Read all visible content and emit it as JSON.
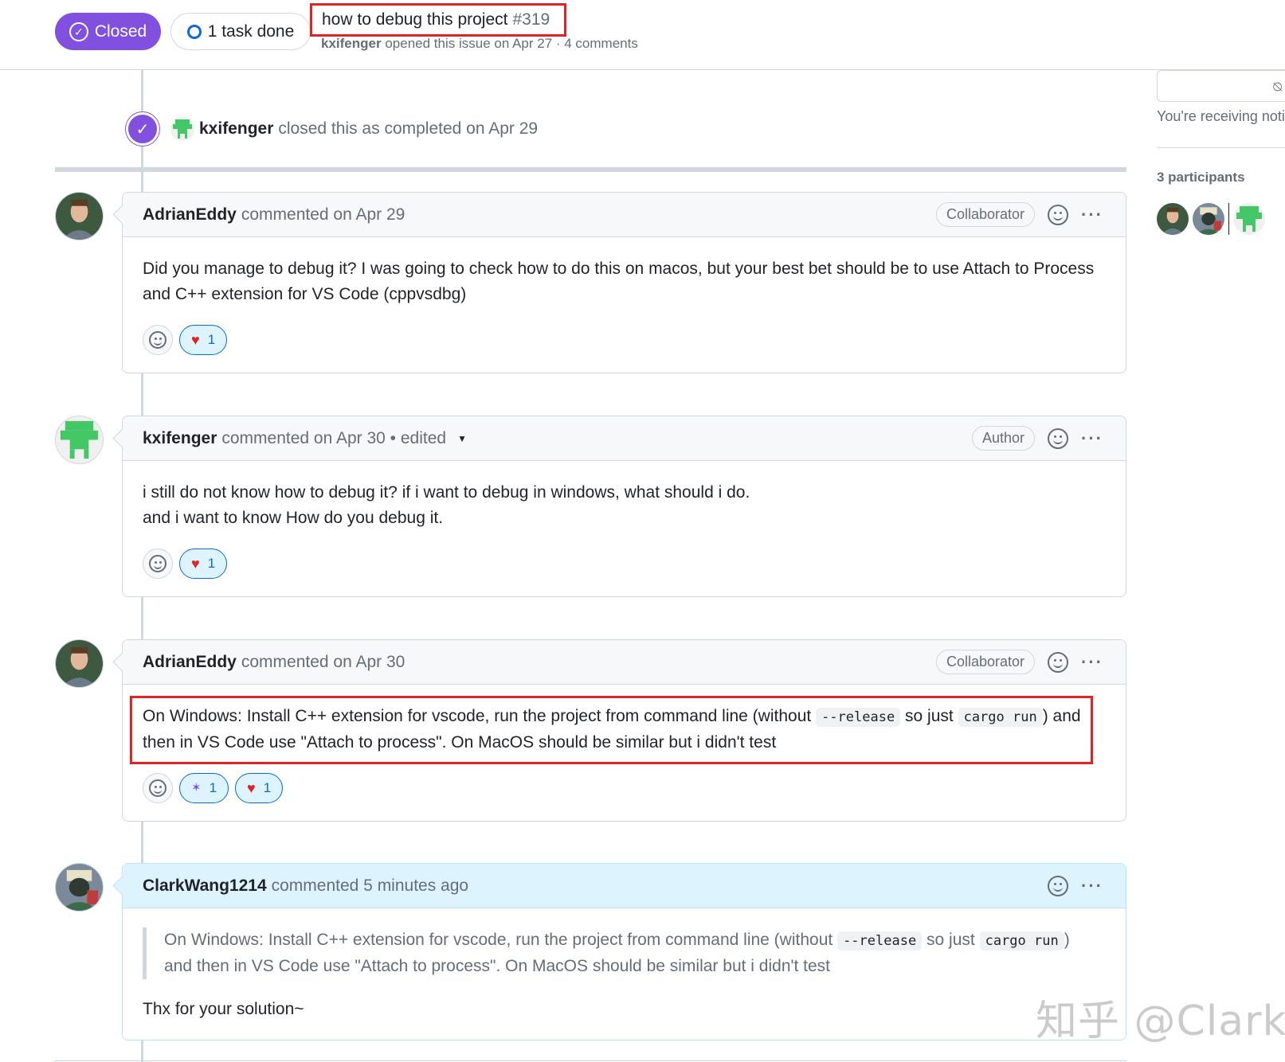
{
  "header": {
    "state_label": "Closed",
    "task_label": "1 task done",
    "title": "how to debug this project",
    "number": "#319",
    "meta_author": "kxifenger",
    "meta_text": "opened this issue on Apr 27 · 4 comments"
  },
  "event": {
    "author": "kxifenger",
    "text": "closed this as completed on Apr 29"
  },
  "comments": [
    {
      "author": "AdrianEddy",
      "header_text": "commented on Apr 29",
      "role": "Collaborator",
      "body_line1": "Did you manage to debug it? I was going to check how to do this on macos, but your best bet should be to use Attach to Process",
      "body_line2": "and C++ extension for VS Code (cppvsdbg)",
      "reaction_heart_count": "1"
    },
    {
      "author": "kxifenger",
      "header_text": "commented on Apr 30 • edited",
      "role": "Author",
      "body_line1": "i still do not know how to debug it? if i want to debug in windows, what should i do.",
      "body_line2": "and i want to know How do you debug it.",
      "reaction_heart_count": "1"
    },
    {
      "author": "AdrianEddy",
      "header_text": "commented on Apr 30",
      "role": "Collaborator",
      "body_part1": "On Windows: Install C++ extension for vscode, run the project from command line (without",
      "code1": "--release",
      "body_part2": "so just",
      "code2": "cargo run",
      "body_part3": ") and",
      "body_line2": "then in VS Code use \"Attach to process\". On MacOS should be similar but i didn't test",
      "reaction_hooray_count": "1",
      "reaction_heart_count": "1"
    },
    {
      "author": "ClarkWang1214",
      "header_text": "commented 5 minutes ago",
      "quote_part1": "On Windows: Install C++ extension for vscode, run the project from command line (without",
      "code1": "--release",
      "quote_part2": "so just",
      "code2": "cargo run",
      "quote_part3": ")",
      "quote_line2": "and then in VS Code use \"Attach to process\". On MacOS should be similar but i didn't test",
      "reply": "Thx for your solution~"
    }
  ],
  "sidebar": {
    "notification_text": "You're receiving noti",
    "participants_title": "3 participants"
  },
  "watermark": "知乎 @Clark",
  "icons": {
    "closed": "check-circle-icon",
    "task": "circle-icon",
    "emoji": "smiley-icon",
    "more": "kebab-icon",
    "heart": "heart-icon",
    "hooray": "party-icon",
    "bell": "bell-slash-icon"
  },
  "colors": {
    "closed_purple": "#8250df",
    "accent_blue": "#0969da",
    "highlight_red": "#e02424",
    "highlight_bg": "#ddf4ff"
  }
}
